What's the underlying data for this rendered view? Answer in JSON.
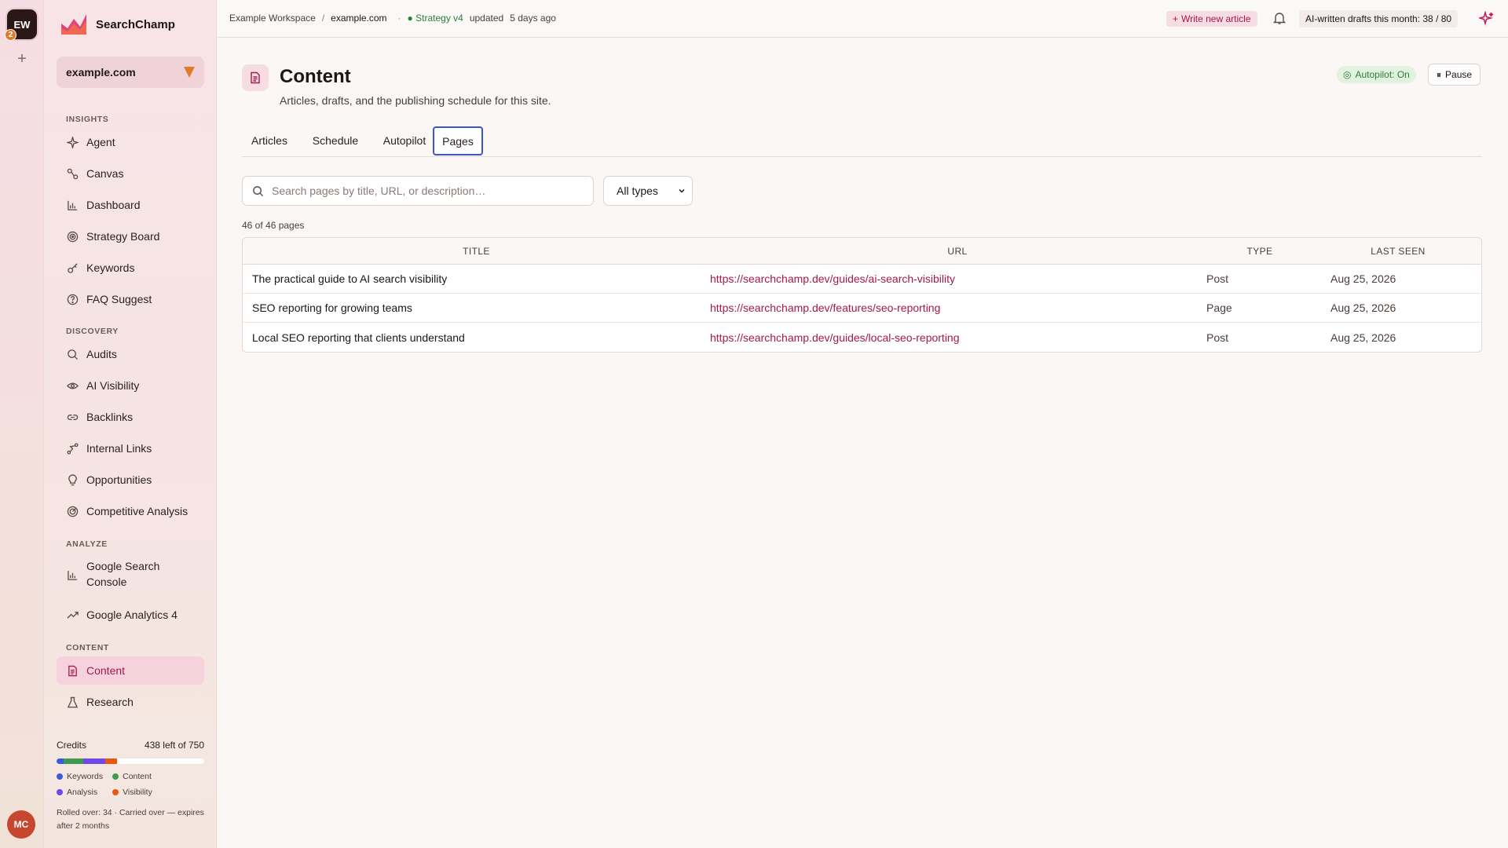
{
  "workspace": {
    "initials": "EW",
    "notifications": "2",
    "user_initials": "MC"
  },
  "brand": {
    "name": "SearchChamp"
  },
  "site_selector": {
    "value": "example.com"
  },
  "sidebar": {
    "sections": [
      {
        "label": "INSIGHTS"
      },
      {
        "label": "DISCOVERY"
      },
      {
        "label": "ANALYZE"
      },
      {
        "label": "CONTENT"
      }
    ],
    "items": [
      {
        "label": "Agent",
        "icon": "sparkle-icon"
      },
      {
        "label": "Canvas",
        "icon": "canvas-icon"
      },
      {
        "label": "Dashboard",
        "icon": "bar-chart-icon"
      },
      {
        "label": "Strategy Board",
        "icon": "target-icon"
      },
      {
        "label": "Keywords",
        "icon": "key-icon"
      },
      {
        "label": "FAQ Suggest",
        "icon": "question-icon"
      },
      {
        "label": "Audits",
        "icon": "search-icon"
      },
      {
        "label": "AI Visibility",
        "icon": "eye-icon"
      },
      {
        "label": "Backlinks",
        "icon": "link-icon"
      },
      {
        "label": "Internal Links",
        "icon": "route-icon"
      },
      {
        "label": "Opportunities",
        "icon": "lightbulb-icon"
      },
      {
        "label": "Competitive Analysis",
        "icon": "radar-icon"
      },
      {
        "label": "Google Search Console",
        "icon": "bar-chart-icon"
      },
      {
        "label": "Google Analytics 4",
        "icon": "trend-icon"
      },
      {
        "label": "Content",
        "icon": "document-icon"
      },
      {
        "label": "Research",
        "icon": "flask-icon"
      }
    ]
  },
  "credits": {
    "label": "Credits",
    "remaining": "438 left of 750",
    "used_fraction": {
      "Keywords": 0.05,
      "Content": 0.13,
      "Analysis": 0.15,
      "Visibility": 0.08
    },
    "legend": [
      "Keywords",
      "Content",
      "Analysis",
      "Visibility"
    ],
    "colors": {
      "Keywords": "#3b5bdb",
      "Content": "#3f9a4f",
      "Analysis": "#7048e8",
      "Visibility": "#e8590c"
    },
    "note": "Rolled over: 34 · Carried over — expires after 2 months"
  },
  "topbar": {
    "breadcrumb_workspace": "Example Workspace",
    "breadcrumb_sep": "/",
    "breadcrumb_site": "example.com",
    "strategy_label": "● Strategy v4",
    "updated_label": "updated",
    "updated_time": "5 days ago",
    "write_button": "Write new article",
    "drafts_quota": "AI-written drafts this month: 38 / 80"
  },
  "page": {
    "title": "Content",
    "subtitle": "Articles, drafts, and the publishing schedule for this site.",
    "autopilot_status": "Autopilot: On",
    "pause_button": "Pause"
  },
  "tabs": [
    {
      "label": "Articles"
    },
    {
      "label": "Schedule"
    },
    {
      "label": "Autopilot"
    },
    {
      "label": "Pages",
      "active": true
    }
  ],
  "filters": {
    "search_placeholder": "Search pages by title, URL, or description…",
    "type_selected": "All types"
  },
  "count_label": "46 of 46 pages",
  "table": {
    "headers": [
      "TITLE",
      "URL",
      "TYPE",
      "LAST SEEN"
    ],
    "rows": [
      {
        "title": "The practical guide to AI search visibility",
        "url": "https://searchchamp.dev/guides/ai-search-visibility",
        "type": "Post",
        "last_seen": "Aug 25, 2026"
      },
      {
        "title": "SEO reporting for growing teams",
        "url": "https://searchchamp.dev/features/seo-reporting",
        "type": "Page",
        "last_seen": "Aug 25, 2026"
      },
      {
        "title": "Local SEO reporting that clients understand",
        "url": "https://searchchamp.dev/guides/local-seo-reporting",
        "type": "Post",
        "last_seen": "Aug 25, 2026"
      }
    ]
  },
  "colors": {
    "accent": "#a4184c",
    "active_tab_border": "#3b55c8",
    "status_green": "#2f7d3a"
  }
}
